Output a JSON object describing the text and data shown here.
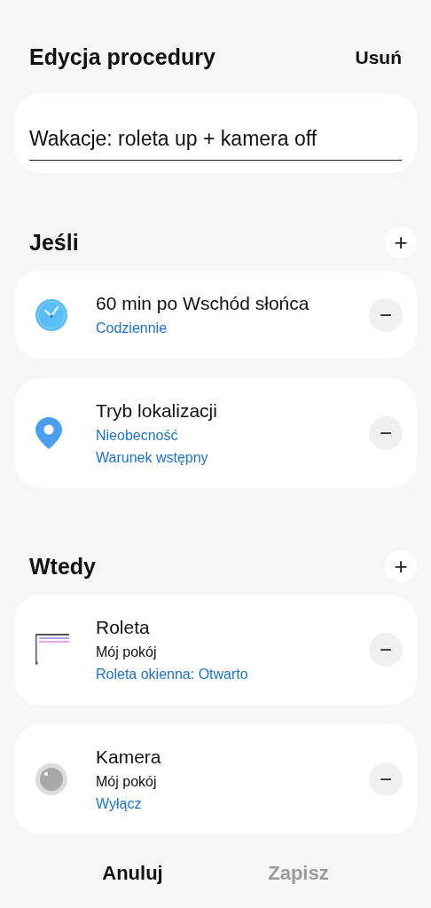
{
  "header": {
    "title": "Edycja procedury",
    "delete_label": "Usuń"
  },
  "name_field": {
    "value": "Wakacje: roleta up + kamera off"
  },
  "sections": [
    {
      "title": "Jeśli",
      "add_label": "+",
      "items": [
        {
          "kind": "clock",
          "title": "60 min po Wschód słońca",
          "lines": [
            {
              "text": "Codziennie",
              "kind": "link"
            }
          ],
          "remove_label": "−"
        },
        {
          "kind": "location",
          "title": "Tryb lokalizacji",
          "lines": [
            {
              "text": "Nieobecność",
              "kind": "link"
            },
            {
              "text": "Warunek wstępny",
              "kind": "link"
            }
          ],
          "remove_label": "−"
        }
      ]
    },
    {
      "title": "Wtedy",
      "add_label": "+",
      "items": [
        {
          "kind": "blind",
          "title": "Roleta",
          "lines": [
            {
              "text": "Mój pokój",
              "kind": "detail"
            },
            {
              "text": "Roleta okienna: Otwarto",
              "kind": "link"
            }
          ],
          "remove_label": "−"
        },
        {
          "kind": "camera",
          "title": "Kamera",
          "lines": [
            {
              "text": "Mój pokój",
              "kind": "detail"
            },
            {
              "text": "Wyłącz",
              "kind": "link"
            }
          ],
          "remove_label": "−"
        }
      ]
    }
  ],
  "footer": [
    {
      "label": "Anuluj",
      "disabled": false
    },
    {
      "label": "Zapisz",
      "disabled": true
    }
  ]
}
